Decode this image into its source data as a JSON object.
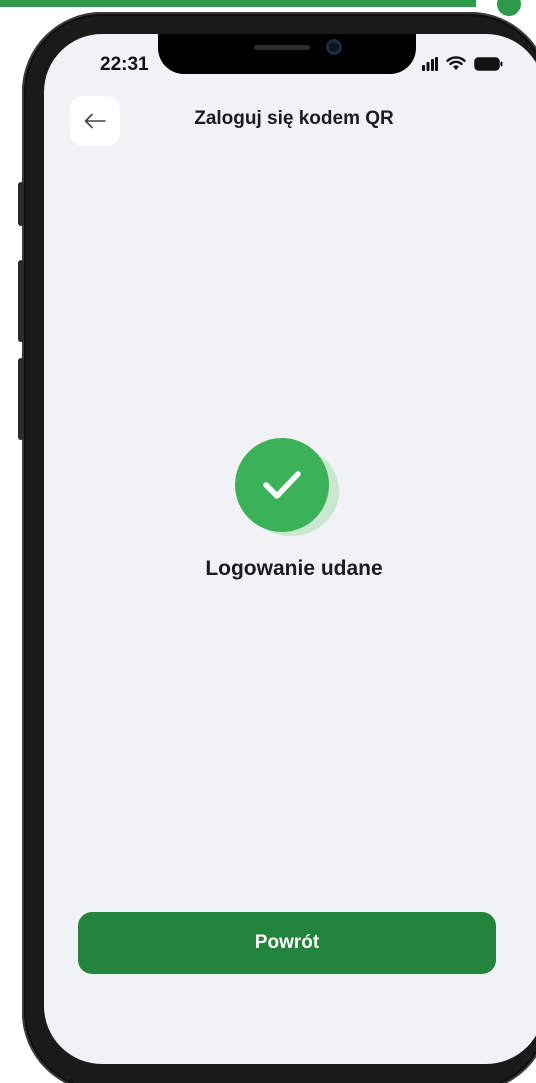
{
  "status_bar": {
    "time": "22:31",
    "icons": [
      "signal-icon",
      "wifi-icon",
      "battery-icon"
    ]
  },
  "header": {
    "back_icon": "arrow-left-icon",
    "title": "Zaloguj się kodem QR"
  },
  "main": {
    "status_icon": "check-icon",
    "message": "Logowanie udane"
  },
  "footer": {
    "button_label": "Powrót"
  },
  "colors": {
    "brand_green": "#23843b",
    "success_green": "#3bb25a",
    "background": "#f1f2f6"
  }
}
